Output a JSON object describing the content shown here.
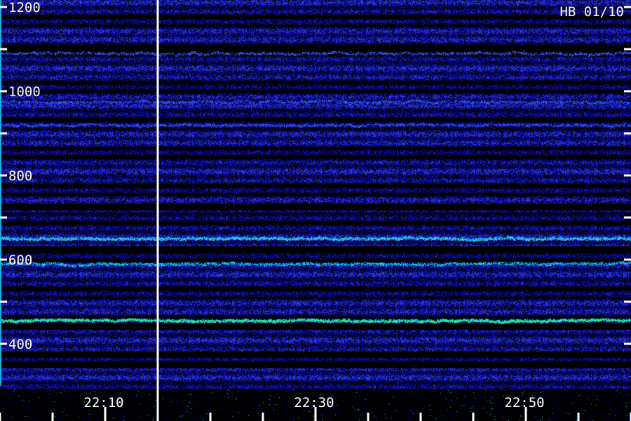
{
  "chart_data": {
    "type": "heatmap",
    "title": "HB 01/10",
    "xlabel": "",
    "ylabel": "",
    "ylim": [
      300,
      1200
    ],
    "y_ticks": [
      {
        "value": 400,
        "label": "400"
      },
      {
        "value": 500,
        "label": ""
      },
      {
        "value": 600,
        "label": "600"
      },
      {
        "value": 700,
        "label": ""
      },
      {
        "value": 800,
        "label": "800"
      },
      {
        "value": 900,
        "label": ""
      },
      {
        "value": 1000,
        "label": "1000"
      },
      {
        "value": 1100,
        "label": ""
      },
      {
        "value": 1200,
        "label": "1200"
      }
    ],
    "x_ticks": [
      {
        "value": "22:10",
        "label": "22:10"
      },
      {
        "value": "22:30",
        "label": "22:30"
      },
      {
        "value": "22:50",
        "label": "22:50"
      }
    ],
    "bands": [
      {
        "center": 455,
        "strength": 0.95,
        "color": "cyan-green"
      },
      {
        "center": 590,
        "strength": 0.55,
        "color": "cyan"
      },
      {
        "center": 650,
        "strength": 0.8,
        "color": "cyan"
      },
      {
        "center": 920,
        "strength": 0.45,
        "color": "blue"
      },
      {
        "center": 975,
        "strength": 0.45,
        "color": "blue"
      },
      {
        "center": 1090,
        "strength": 0.5,
        "color": "blue"
      }
    ],
    "colors": {
      "background": "#000000",
      "dark": "#000020",
      "noise": "#1010c0",
      "bright": "#3050ff",
      "cyan": "#20d0e0",
      "green": "#40ff70",
      "divider": "#ffffff"
    }
  }
}
